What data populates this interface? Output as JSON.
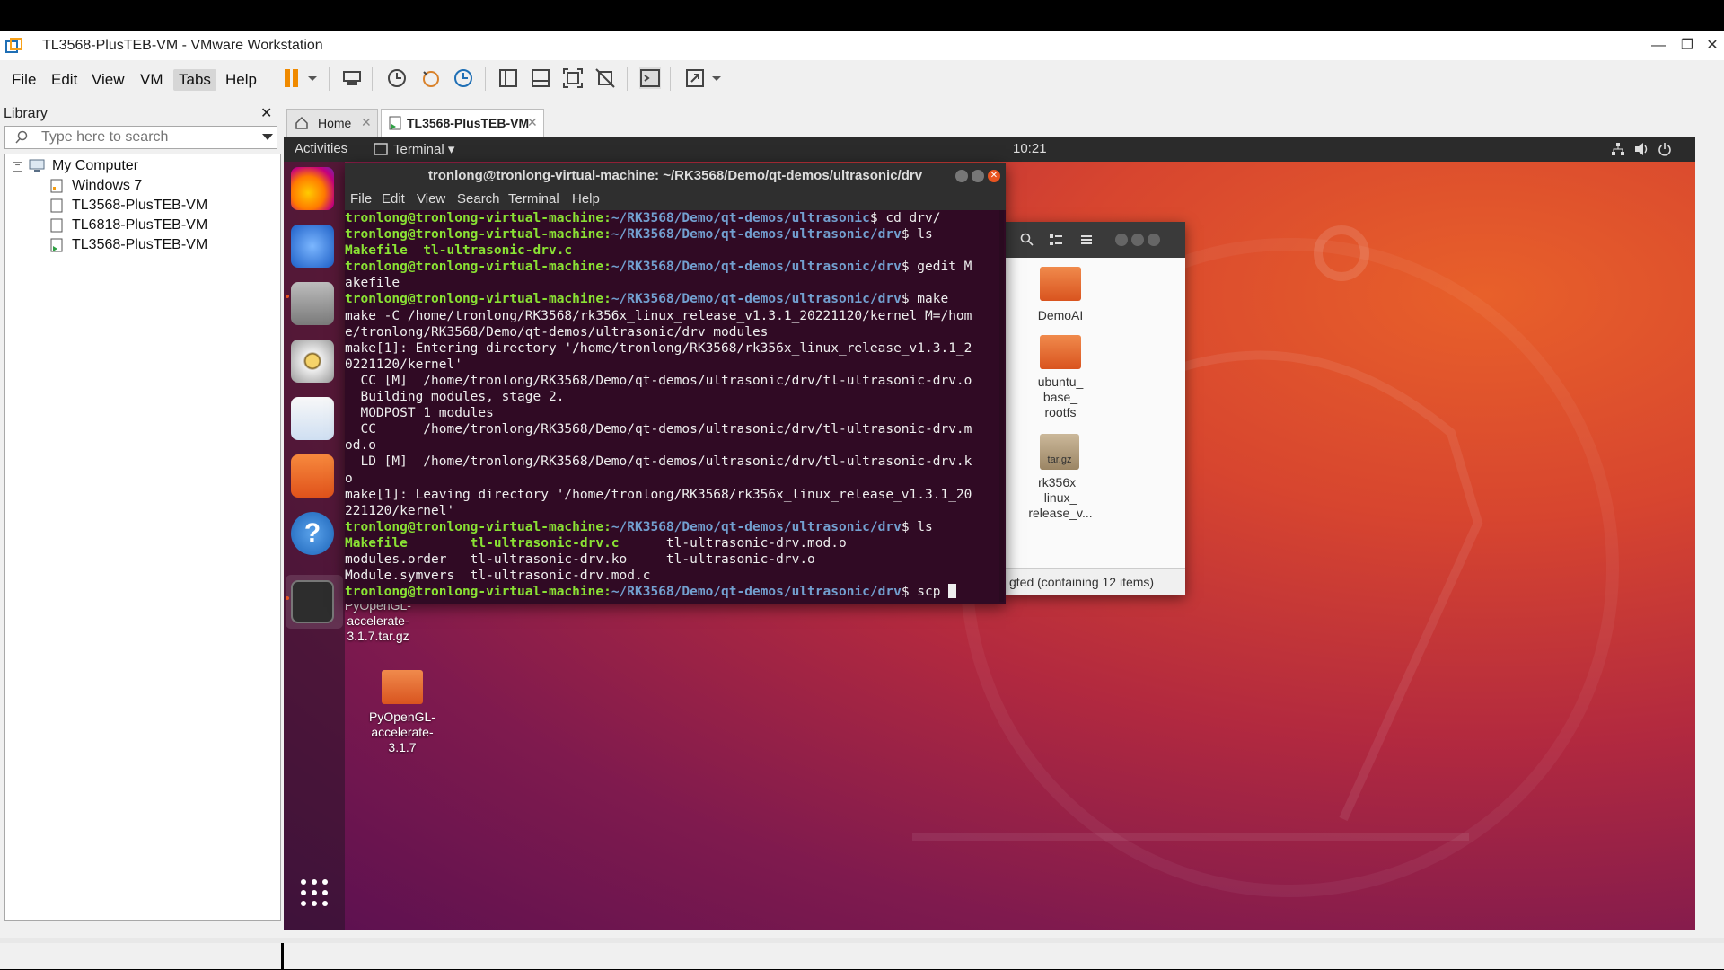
{
  "window": {
    "title": "TL3568-PlusTEB-VM - VMware Workstation",
    "controls": [
      "—",
      "❐",
      "✕"
    ]
  },
  "menubar": {
    "items": [
      "File",
      "Edit",
      "View",
      "VM",
      "Tabs",
      "Help"
    ],
    "selected": "Tabs"
  },
  "library": {
    "title": "Library",
    "close": "✕",
    "search_placeholder": "Type here to search",
    "tree": [
      {
        "label": "My Computer",
        "level": 0
      },
      {
        "label": "Windows 7",
        "level": 1
      },
      {
        "label": "TL3568-PlusTEB-VM",
        "level": 1
      },
      {
        "label": "TL6818-PlusTEB-VM",
        "level": 1
      },
      {
        "label": "TL3568-PlusTEB-VM",
        "level": 1
      }
    ]
  },
  "tabs": [
    {
      "label": "Home",
      "close": "✕",
      "active": false
    },
    {
      "label": "TL3568-PlusTEB-VM",
      "close": "✕",
      "active": true
    }
  ],
  "guest": {
    "topbar": {
      "activities": "Activities",
      "app_menu": "Terminal ▾",
      "clock": "10:21"
    },
    "terminal": {
      "title": "tronlong@tronlong-virtual-machine: ~/RK3568/Demo/qt-demos/ultrasonic/drv",
      "menu": [
        "File",
        "Edit",
        "View",
        "Search",
        "Terminal",
        "Help"
      ],
      "user": "tronlong@tronlong-virtual-machine:",
      "lines": [
        {
          "p": "~/RK3568/Demo/qt-demos/ultrasonic",
          "t": "$ cd drv/"
        },
        {
          "p": "~/RK3568/Demo/qt-demos/ultrasonic/drv",
          "t": "$ ls"
        },
        {
          "g": "Makefile  tl-ultrasonic-drv.c"
        },
        {
          "p": "~/RK3568/Demo/qt-demos/ultrasonic/drv",
          "t": "$ gedit M"
        },
        {
          "t": "akefile"
        },
        {
          "p": "~/RK3568/Demo/qt-demos/ultrasonic/drv",
          "t": "$ make"
        },
        {
          "t": "make -C /home/tronlong/RK3568/rk356x_linux_release_v1.3.1_20221120/kernel M=/hom"
        },
        {
          "t": "e/tronlong/RK3568/Demo/qt-demos/ultrasonic/drv modules"
        },
        {
          "t": "make[1]: Entering directory '/home/tronlong/RK3568/rk356x_linux_release_v1.3.1_2"
        },
        {
          "t": "0221120/kernel'"
        },
        {
          "t": "  CC [M]  /home/tronlong/RK3568/Demo/qt-demos/ultrasonic/drv/tl-ultrasonic-drv.o"
        },
        {
          "t": "  Building modules, stage 2."
        },
        {
          "t": "  MODPOST 1 modules"
        },
        {
          "t": "  CC      /home/tronlong/RK3568/Demo/qt-demos/ultrasonic/drv/tl-ultrasonic-drv.m"
        },
        {
          "t": "od.o"
        },
        {
          "t": "  LD [M]  /home/tronlong/RK3568/Demo/qt-demos/ultrasonic/drv/tl-ultrasonic-drv.k"
        },
        {
          "t": "o"
        },
        {
          "t": "make[1]: Leaving directory '/home/tronlong/RK3568/rk356x_linux_release_v1.3.1_20"
        },
        {
          "t": "221120/kernel'"
        },
        {
          "p": "~/RK3568/Demo/qt-demos/ultrasonic/drv",
          "t": "$ ls"
        },
        {
          "g": "Makefile        tl-ultrasonic-drv.c",
          "t": "      tl-ultrasonic-drv.mod.o"
        },
        {
          "t": "modules.order   tl-ultrasonic-drv.ko     tl-ultrasonic-drv.o"
        },
        {
          "t": "Module.symvers  tl-ultrasonic-drv.mod.c"
        },
        {
          "p": "~/RK3568/Demo/qt-demos/ultrasonic/drv",
          "t": "$ scp "
        }
      ]
    },
    "files": {
      "items": [
        "DemoAI",
        "ubuntu_\nbase_\nrootfs",
        "rk356x_\nlinux_\nrelease_v..."
      ],
      "tar_label": "tar.gz",
      "status": "gted  (containing 12 items)"
    },
    "desktop": {
      "items": [
        "PyOpenGL-\naccelerate-\n3.1.7.tar.gz",
        "PyOpenGL-\naccelerate-\n3.1.7"
      ]
    },
    "colors": {
      "accent": "#e95420",
      "terminal_bg": "#300a24",
      "prompt_user": "#8ae234",
      "prompt_path": "#729fcf"
    }
  }
}
